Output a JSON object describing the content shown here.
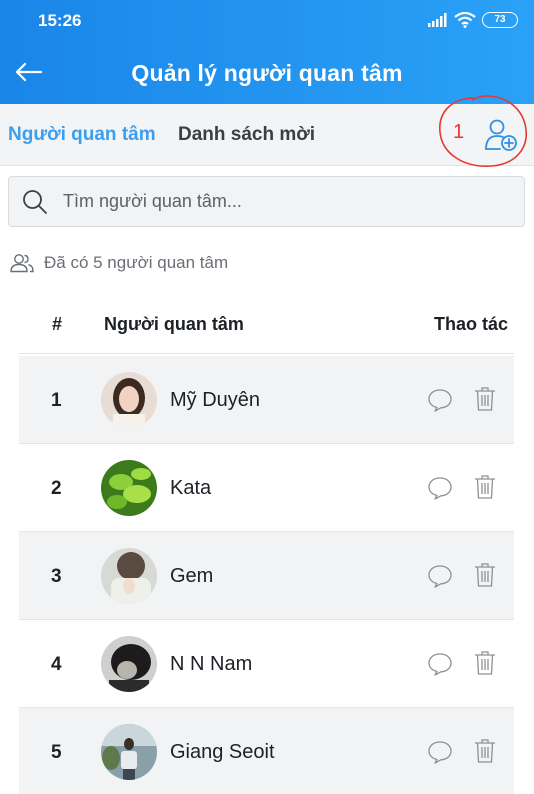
{
  "status_bar": {
    "time": "15:26",
    "battery": "73"
  },
  "header": {
    "title": "Quản lý người quan tâm"
  },
  "tabs": [
    {
      "label": "Người quan tâm",
      "active": true
    },
    {
      "label": "Danh sách mời",
      "active": false
    }
  ],
  "annotation": {
    "marker": "1",
    "color": "#e53935"
  },
  "search": {
    "placeholder": "Tìm người quan tâm..."
  },
  "summary": {
    "text": "Đã có 5 người quan tâm"
  },
  "table": {
    "headers": {
      "number": "#",
      "name": "Người quan tâm",
      "actions": "Thao tác"
    },
    "rows": [
      {
        "number": "1",
        "name": "Mỹ Duyên"
      },
      {
        "number": "2",
        "name": "Kata"
      },
      {
        "number": "3",
        "name": "Gem"
      },
      {
        "number": "4",
        "name": "N N Nam"
      },
      {
        "number": "5",
        "name": "Giang Seoit"
      }
    ]
  },
  "icons": [
    "back-arrow-icon",
    "signal-icon",
    "wifi-icon",
    "battery-icon",
    "add-user-icon",
    "search-icon",
    "users-icon",
    "chat-icon",
    "trash-icon"
  ],
  "colors": {
    "header_start": "#1a86e8",
    "header_end": "#2aa1f7",
    "accent": "#3a9ff0",
    "row_alt": "#f1f3f5"
  }
}
